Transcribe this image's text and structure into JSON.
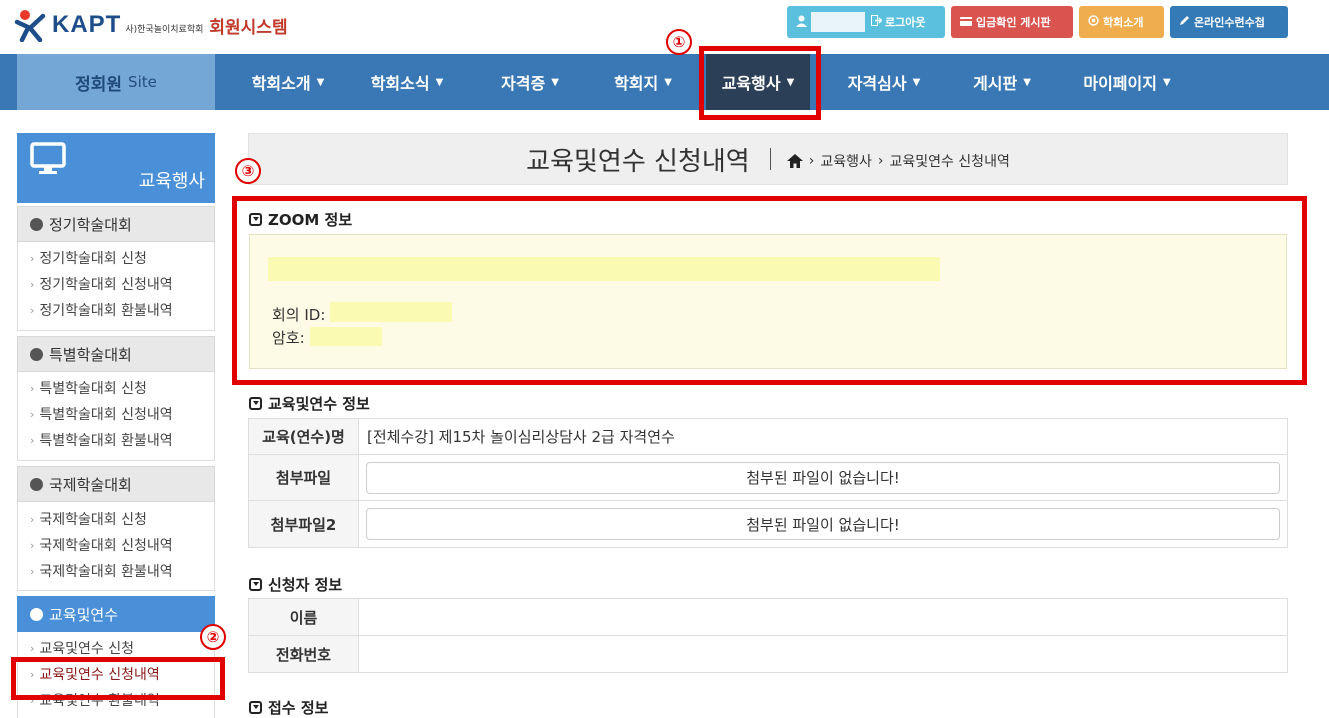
{
  "header": {
    "logo_text": "KAPT",
    "logo_sub": "사)한국놀이치료학회",
    "system_name": "회원시스템",
    "buttons": {
      "logout": "로그아웃",
      "payment_board": "입금확인 게시판",
      "about": "학회소개",
      "online_cert": "온라인수련수첩"
    }
  },
  "nav": {
    "site_label": "정회원",
    "site_suffix": "Site",
    "items": [
      {
        "label": "학회소개"
      },
      {
        "label": "학회소식"
      },
      {
        "label": "자격증"
      },
      {
        "label": "학회지"
      },
      {
        "label": "교육행사"
      },
      {
        "label": "자격심사"
      },
      {
        "label": "게시판"
      },
      {
        "label": "마이페이지"
      }
    ],
    "active_index": 4
  },
  "annotations": [
    "①",
    "②",
    "③"
  ],
  "sidebar": {
    "title": "교육행사",
    "sections": [
      {
        "label": "정기학술대회",
        "items": [
          "정기학술대회 신청",
          "정기학술대회 신청내역",
          "정기학술대회 환불내역"
        ]
      },
      {
        "label": "특별학술대회",
        "items": [
          "특별학술대회 신청",
          "특별학술대회 신청내역",
          "특별학술대회 환불내역"
        ]
      },
      {
        "label": "국제학술대회",
        "items": [
          "국제학술대회 신청",
          "국제학술대회 신청내역",
          "국제학술대회 환불내역"
        ]
      },
      {
        "label": "교육및연수",
        "items": [
          "교육및연수 신청",
          "교육및연수 신청내역",
          "교육및연수 환불내역"
        ]
      }
    ]
  },
  "page": {
    "title": "교육및연수 신청내역",
    "breadcrumb": [
      "교육행사",
      "교육및연수 신청내역"
    ]
  },
  "zoom": {
    "heading": "ZOOM 정보",
    "meeting_id_label": "회의 ID:",
    "password_label": "암호:"
  },
  "edu": {
    "heading": "교육및연수 정보",
    "name_label": "교육(연수)명",
    "name_value": "[전체수강] 제15차 놀이심리상담사 2급 자격연수",
    "file1_label": "첨부파일",
    "file1_value": "첨부된 파일이 없습니다!",
    "file2_label": "첨부파일2",
    "file2_value": "첨부된 파일이 없습니다!"
  },
  "applicant": {
    "heading": "신청자 정보",
    "name_label": "이름",
    "phone_label": "전화번호"
  },
  "receipt": {
    "heading": "접수 정보"
  },
  "colors": {
    "nav_bg": "#3a78b5",
    "nav_active": "#2b3f57",
    "annotation_red": "#e00000",
    "sidebar_blue": "#4a90d9"
  }
}
